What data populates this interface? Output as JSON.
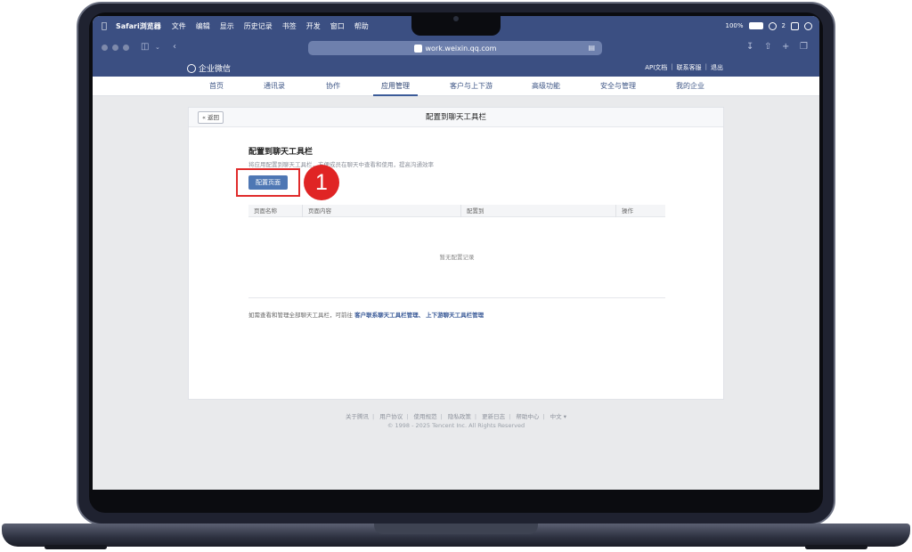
{
  "menubar": {
    "app": "Safari浏览器",
    "items": [
      "文件",
      "编辑",
      "显示",
      "历史记录",
      "书签",
      "开发",
      "窗口",
      "帮助"
    ],
    "battery": "100%",
    "wechat_count": "2"
  },
  "browser": {
    "url": "work.weixin.qq.com"
  },
  "wecom": {
    "logo_text": "企业微信",
    "top_links": [
      "API文档",
      "联系客服",
      "退出"
    ],
    "nav": [
      "首页",
      "通讯录",
      "协作",
      "应用管理",
      "客户与上下游",
      "高级功能",
      "安全与管理",
      "我的企业"
    ],
    "active_nav": "应用管理"
  },
  "card": {
    "back_label": "« 返回",
    "title": "配置到聊天工具栏",
    "section_title": "配置到聊天工具栏",
    "section_desc": "将应用配置到聊天工具栏，方便成员在聊天中查看和使用，提高沟通效率",
    "config_button": "配置页面",
    "step_number": "1",
    "table_headers": [
      "页面名称",
      "页面内容",
      "配置到",
      "操作"
    ],
    "empty_text": "暂无配置记录",
    "note_prefix": "如需查看和管理全部聊天工具栏，可前往",
    "note_link1": "客户联系聊天工具栏管理",
    "note_sep": "、",
    "note_link2": "上下游聊天工具栏管理"
  },
  "footer": {
    "links": [
      "关于腾讯",
      "用户协议",
      "使用规范",
      "隐私政策",
      "更新日志",
      "帮助中心",
      "中文 ▾"
    ],
    "copyright": "© 1998 - 2025 Tencent Inc. All Rights Reserved"
  },
  "colors": {
    "brand_blue": "#3b4f82",
    "button_blue": "#4e77b4",
    "highlight_red": "#e02b2b"
  }
}
